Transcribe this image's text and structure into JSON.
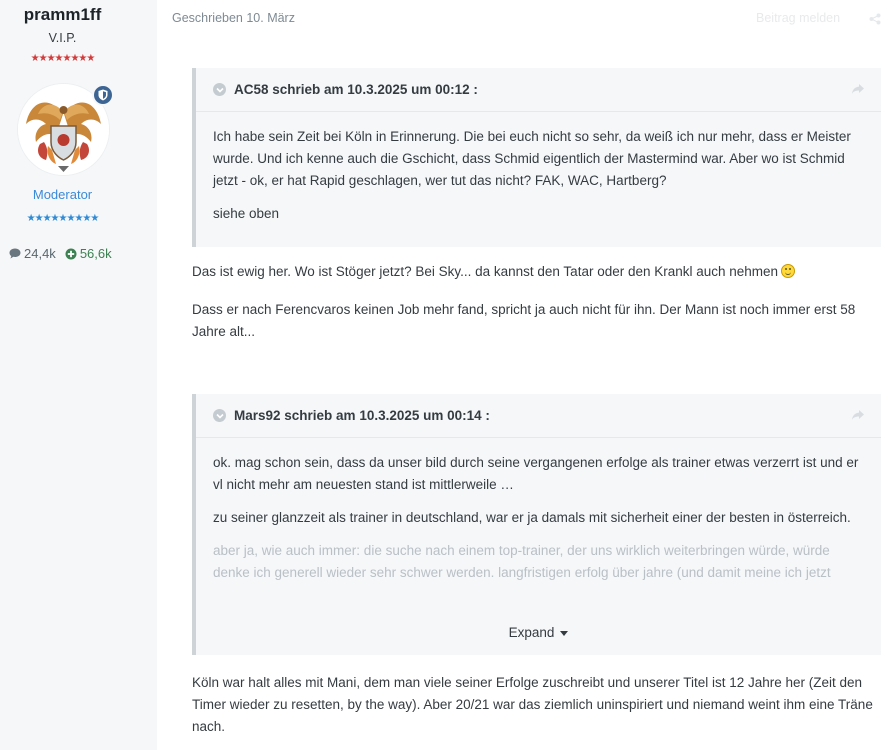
{
  "author": {
    "name": "pramm1ff",
    "group": "V.I.P.",
    "stars_top": "★★★★★★★★",
    "role": "Moderator",
    "stars_role": "★★★★★★★★★",
    "posts": "24,4k",
    "reputation": "56,6k",
    "badge_icon": "shield-badge-icon",
    "avatar_desc": "avatar-crest"
  },
  "post": {
    "date": "Geschrieben 10. März",
    "report": "Beitrag melden",
    "quote1": {
      "citation": "AC58 schrieb am 10.3.2025 um 00:12 :",
      "paragraphs": [
        "Ich habe sein Zeit bei Köln in Erinnerung. Die bei euch nicht so sehr, da weiß ich nur mehr, dass er Meister wurde. Und ich kenne auch die Gschicht, dass Schmid eigentlich der Mastermind war. Aber wo ist Schmid jetzt - ok, er hat Rapid geschlagen, wer tut das nicht? FAK, WAC, Hartberg?",
        "siehe oben"
      ]
    },
    "text1": "Das ist ewig her. Wo ist Stöger jetzt? Bei Sky... da kannst den Tatar oder den Krankl auch nehmen",
    "text2": "Dass er nach Ferencvaros keinen Job mehr fand, spricht ja auch nicht für ihn. Der Mann ist noch immer erst 58 Jahre alt...",
    "quote2": {
      "citation": "Mars92 schrieb am 10.3.2025 um 00:14 :",
      "paragraphs": [
        "ok. mag schon sein, dass da unser bild durch seine vergangenen erfolge als trainer etwas verzerrt ist und er vl nicht mehr am neuesten stand ist mittlerweile …",
        "zu seiner glanzzeit als trainer in deutschland, war er ja damals mit sicherheit einer der besten in österreich.",
        "aber ja, wie auch immer: die suche nach einem top-trainer, der uns wirklich weiterbringen würde, würde denke ich generell wieder sehr schwer werden. langfristigen erfolg über jahre (und damit meine ich jetzt"
      ],
      "expand_label": "Expand"
    },
    "text3": "Köln war halt alles mit Mani, dem man viele seiner Erfolge zuschreibt und unserer Titel ist 12 Jahre her (Zeit den Timer wieder zu resetten, by the way). Aber 20/21 war das ziemlich uninspiriert und niemand weint ihm eine Träne nach."
  }
}
